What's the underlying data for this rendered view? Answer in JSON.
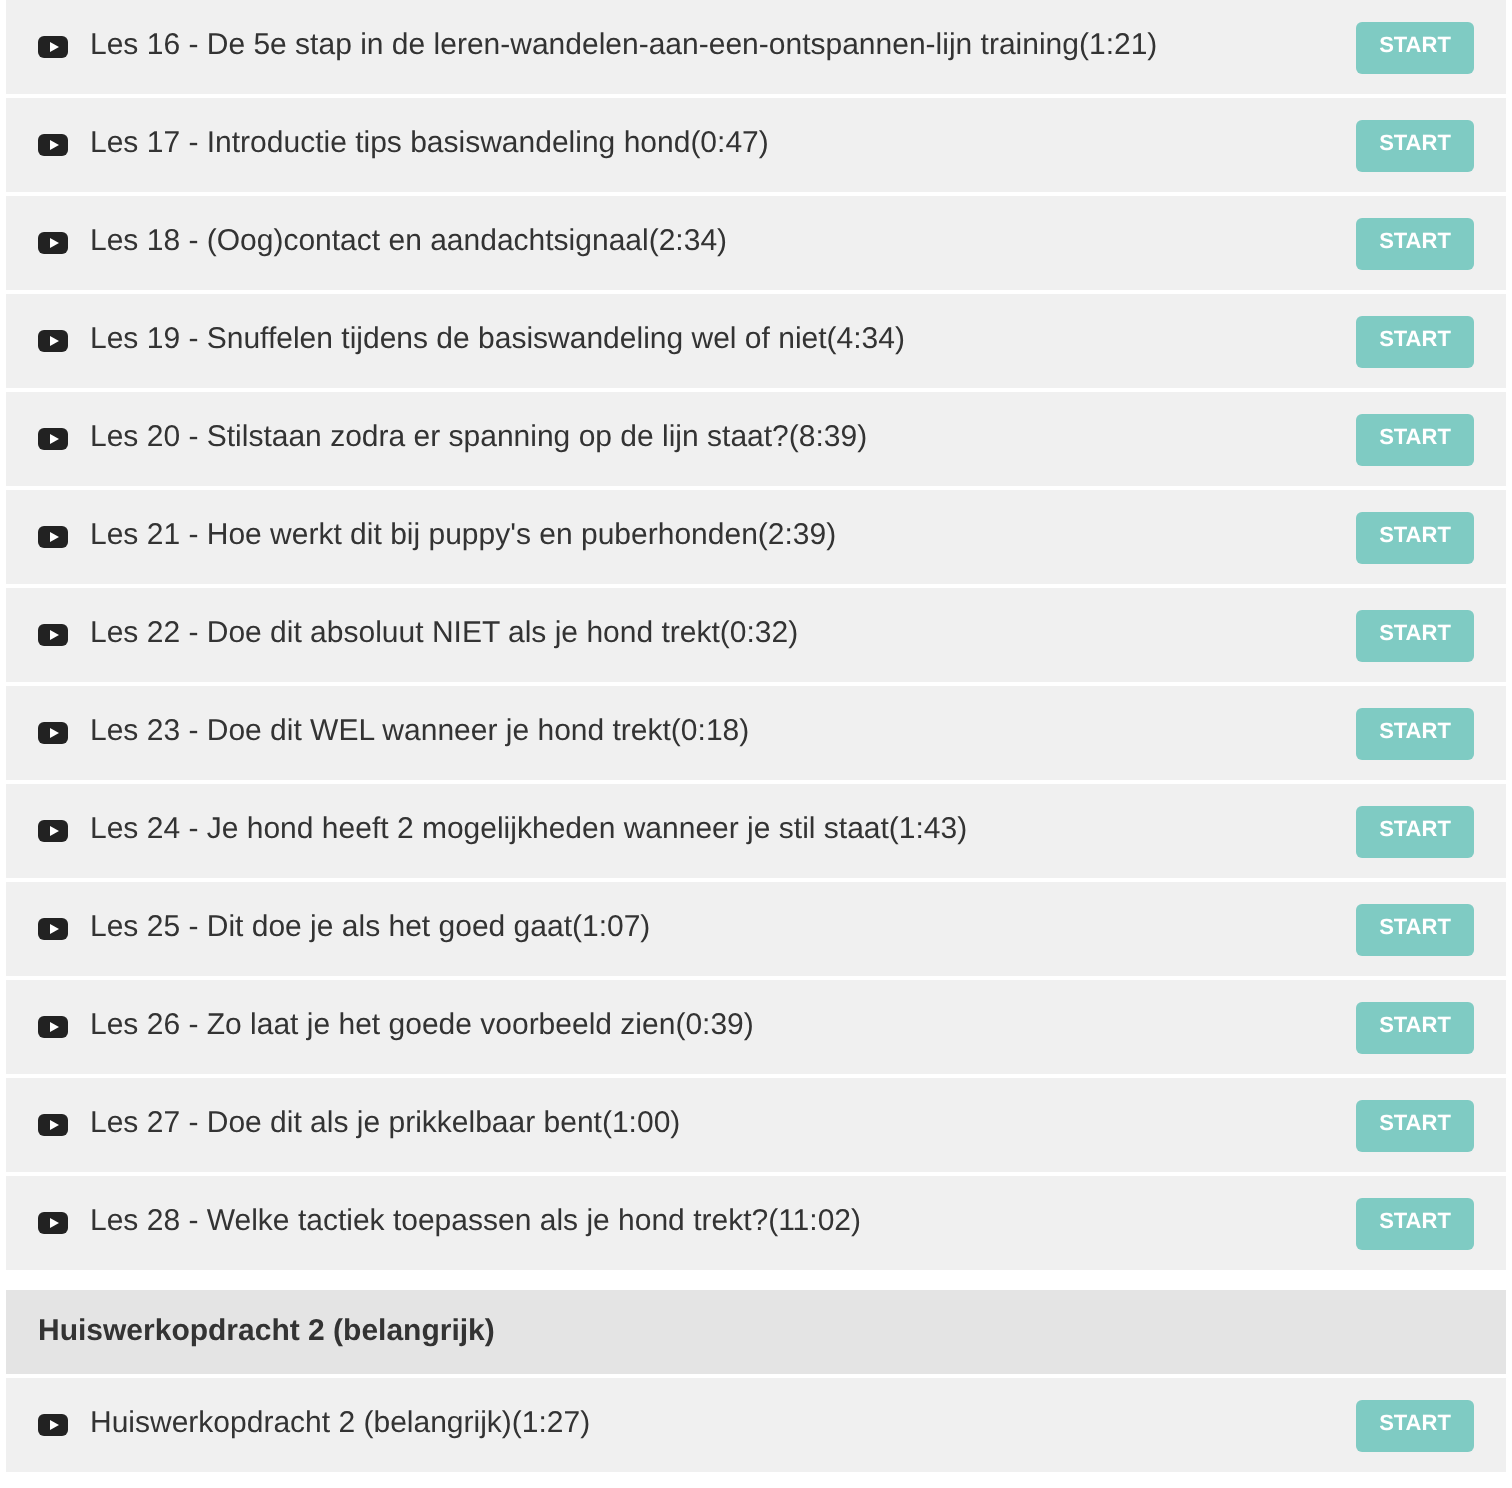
{
  "sections": [
    {
      "lessons": [
        {
          "title": "Les 16 - De 5e stap in de leren-wandelen-aan-een-ontspannen-lijn training(1:21)",
          "button": "START"
        },
        {
          "title": "Les 17 - Introductie tips basiswandeling hond(0:47)",
          "button": "START"
        },
        {
          "title": "Les 18 - (Oog)contact en aandachtsignaal(2:34)",
          "button": "START"
        },
        {
          "title": "Les 19 - Snuffelen tijdens de basiswandeling wel of niet(4:34)",
          "button": "START"
        },
        {
          "title": "Les 20 - Stilstaan zodra er spanning op de lijn staat?(8:39)",
          "button": "START"
        },
        {
          "title": "Les 21 - Hoe werkt dit bij puppy's en puberhonden(2:39)",
          "button": "START"
        },
        {
          "title": "Les 22 - Doe dit absoluut NIET als je hond trekt(0:32)",
          "button": "START"
        },
        {
          "title": "Les 23 - Doe dit WEL wanneer je hond trekt(0:18)",
          "button": "START"
        },
        {
          "title": "Les 24 - Je hond heeft 2 mogelijkheden wanneer je stil staat(1:43)",
          "button": "START"
        },
        {
          "title": "Les 25 - Dit doe je als het goed gaat(1:07)",
          "button": "START"
        },
        {
          "title": "Les 26 - Zo laat je het goede voorbeeld zien(0:39)",
          "button": "START"
        },
        {
          "title": "Les 27 - Doe dit als je prikkelbaar bent(1:00)",
          "button": "START"
        },
        {
          "title": "Les 28 - Welke tactiek toepassen als je hond trekt?(11:02)",
          "button": "START"
        }
      ]
    },
    {
      "title": "Huiswerkopdracht 2 (belangrijk)",
      "lessons": [
        {
          "title": "Huiswerkopdracht 2 (belangrijk)(1:27)",
          "button": "START"
        }
      ]
    }
  ]
}
